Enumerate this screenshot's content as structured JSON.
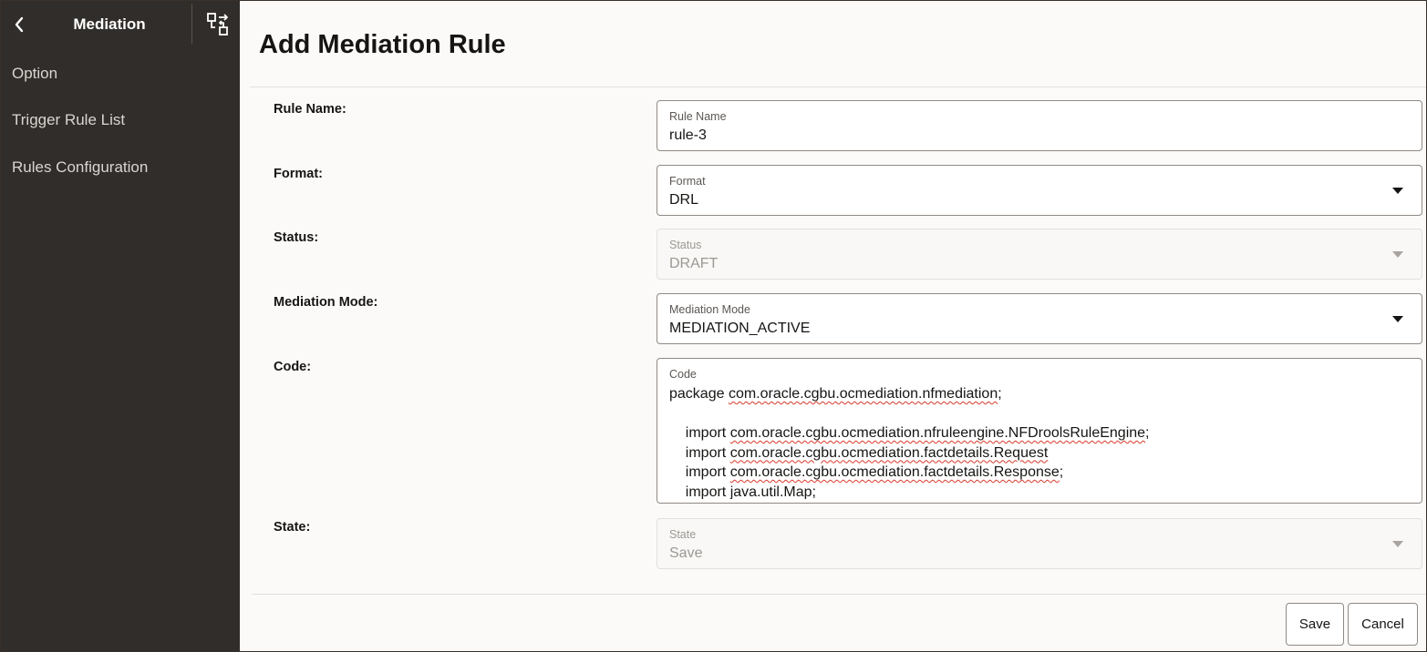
{
  "sidebar": {
    "title": "Mediation",
    "items": [
      {
        "label": "Option"
      },
      {
        "label": "Trigger Rule List"
      },
      {
        "label": "Rules Configuration"
      }
    ]
  },
  "page": {
    "title": "Add Mediation Rule"
  },
  "form": {
    "rule_name": {
      "row_label": "Rule Name:",
      "field_label": "Rule Name",
      "value": "rule-3"
    },
    "format": {
      "row_label": "Format:",
      "field_label": "Format",
      "value": "DRL"
    },
    "status": {
      "row_label": "Status:",
      "field_label": "Status",
      "value": "DRAFT"
    },
    "mediation_mode": {
      "row_label": "Mediation Mode:",
      "field_label": "Mediation Mode",
      "value": "MEDIATION_ACTIVE"
    },
    "code": {
      "row_label": "Code:",
      "field_label": "Code",
      "lines": [
        {
          "prefix": "package ",
          "ref": "com.oracle.cgbu.ocmediation.nfmediation",
          "suffix": ";"
        },
        {
          "prefix": "",
          "ref": "",
          "suffix": ""
        },
        {
          "prefix": "    import ",
          "ref": "com.oracle.cgbu.ocmediation.nfruleengine.NFDroolsRuleEngine",
          "suffix": ";"
        },
        {
          "prefix": "    import ",
          "ref": "com.oracle.cgbu.ocmediation.factdetails.Request",
          "suffix": ""
        },
        {
          "prefix": "    import ",
          "ref": "com.oracle.cgbu.ocmediation.factdetails.Response",
          "suffix": ";"
        },
        {
          "prefix": "    import ",
          "ref": "java.util.Map",
          "suffix": ";"
        }
      ]
    },
    "state": {
      "row_label": "State:",
      "field_label": "State",
      "value": "Save"
    }
  },
  "buttons": {
    "save": "Save",
    "cancel": "Cancel"
  },
  "icons": {
    "back": "chevron-left-icon",
    "swap": "swap-layout-icon",
    "dropdown": "chevron-down-icon"
  },
  "colors": {
    "sidebar_bg": "#312d2a",
    "page_bg": "#fbfaf8",
    "spellcheck": "#d83a2a"
  }
}
